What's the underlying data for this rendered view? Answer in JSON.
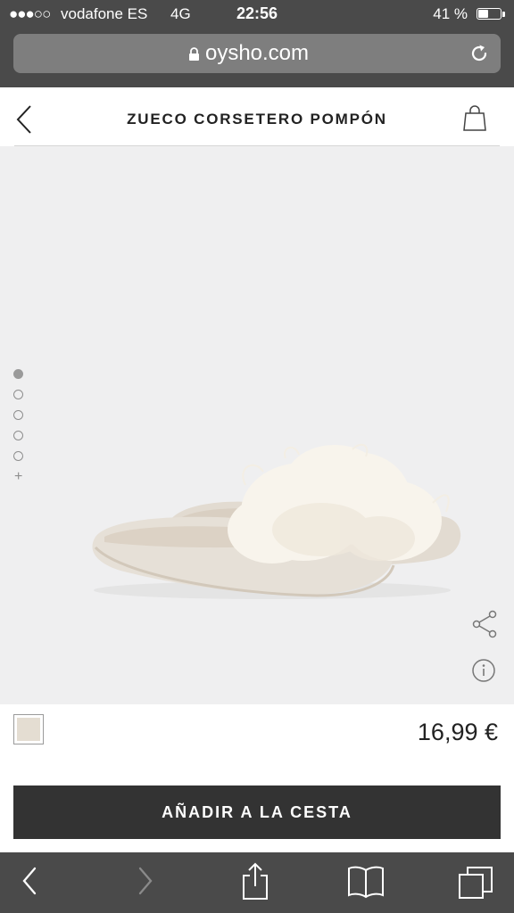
{
  "status_bar": {
    "signal": "●●●○○",
    "carrier": "vodafone ES",
    "network": "4G",
    "time": "22:56",
    "battery": "41 %",
    "battery_level": 0.41
  },
  "browser": {
    "url": "oysho.com"
  },
  "header": {
    "title": "ZUECO CORSETERO POMPÓN"
  },
  "gallery": {
    "dots": [
      true,
      false,
      false,
      false,
      false
    ],
    "more": "+"
  },
  "product": {
    "price": "16,99 €",
    "swatch_color": "#e4ddd2",
    "add_to_cart": "AÑADIR A LA CESTA"
  },
  "colors": {
    "chrome": "#4a4a4a",
    "button": "#333333",
    "image_bg": "#efeff0"
  },
  "icons": [
    "lock-icon",
    "reload-icon",
    "back-arrow-icon",
    "shopping-bag-icon",
    "share-icon",
    "info-icon",
    "nav-back-icon",
    "nav-forward-icon",
    "share-action-icon",
    "bookmarks-icon",
    "tabs-icon"
  ]
}
